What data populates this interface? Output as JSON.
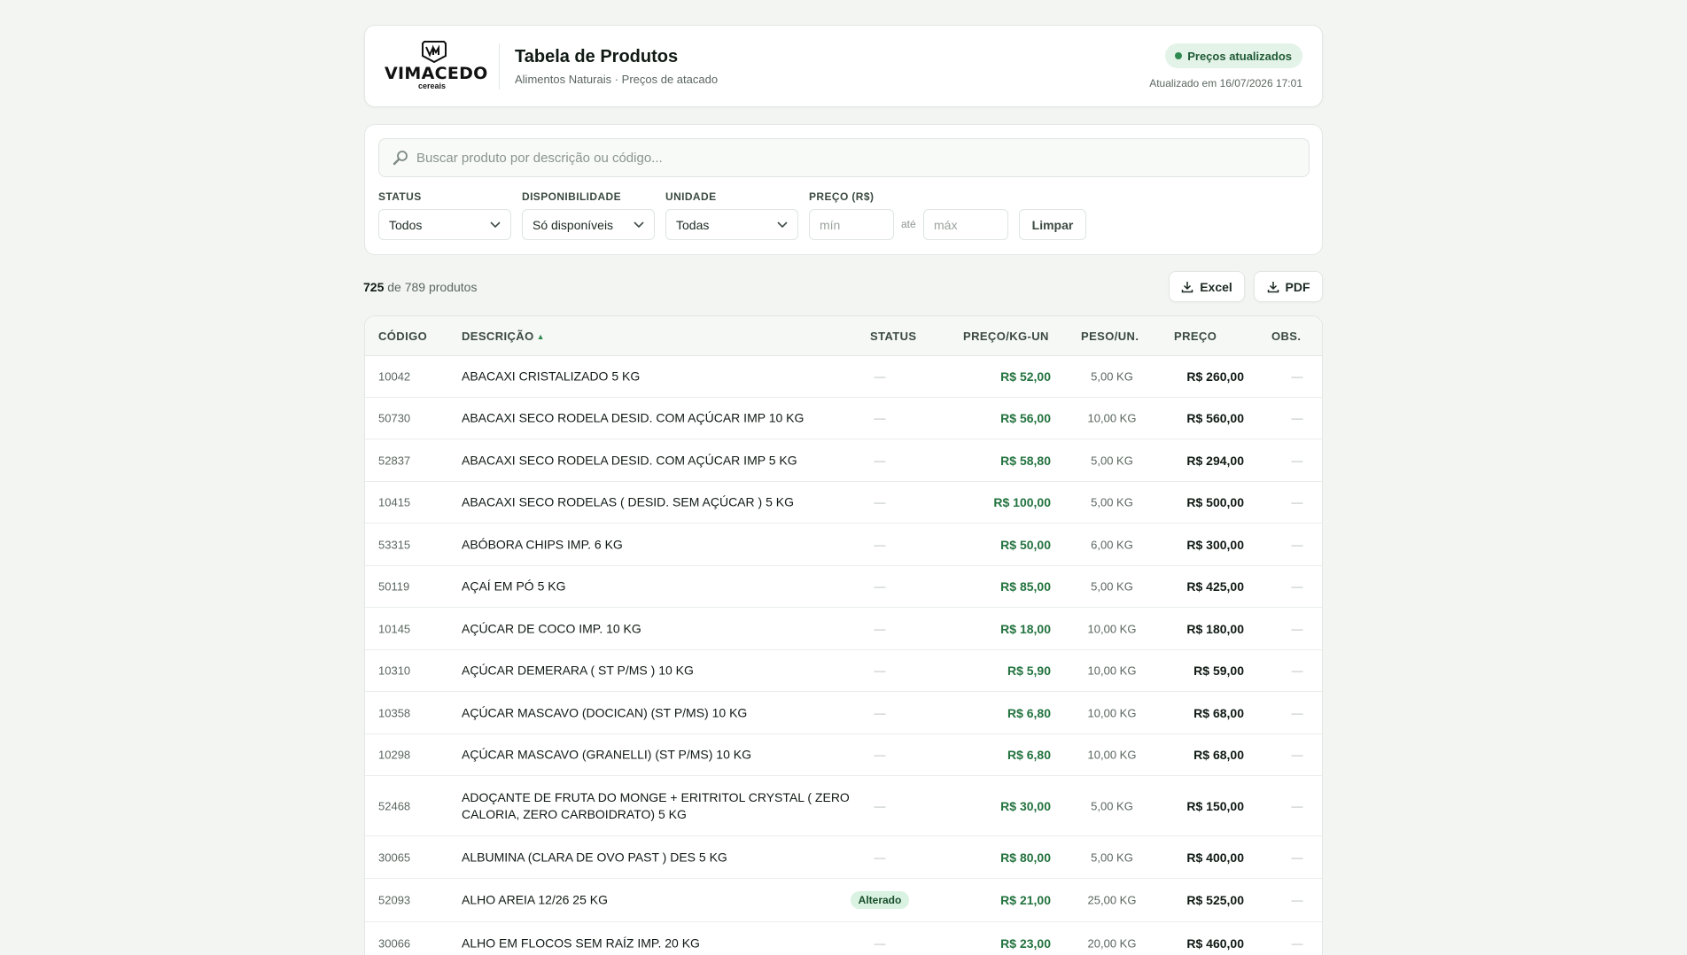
{
  "brand": {
    "logo_text": "VIMACEDO",
    "logo_sub": "cereais"
  },
  "header": {
    "title": "Tabela de Produtos",
    "subtitle": "Alimentos Naturais · Preços de atacado",
    "badge": "Preços atualizados",
    "updated_at": "Atualizado em 16/07/2026 17:01"
  },
  "search": {
    "placeholder": "Buscar produto por descrição ou código...",
    "value": ""
  },
  "filters": {
    "status": {
      "label": "STATUS",
      "value": "Todos"
    },
    "availability": {
      "label": "DISPONIBILIDADE",
      "value": "Só disponíveis"
    },
    "unit": {
      "label": "UNIDADE",
      "value": "Todas"
    },
    "price": {
      "label": "PREÇO (R$)",
      "min_placeholder": "mín",
      "max_placeholder": "máx",
      "separator": "até"
    },
    "clear_label": "Limpar"
  },
  "results": {
    "shown": "725",
    "total_text": "de 789 produtos"
  },
  "export": {
    "excel": "Excel",
    "pdf": "PDF"
  },
  "colors": {
    "accent": "#2e8b4f",
    "price_green": "#23733f",
    "badge_bg": "#e3f3e8"
  },
  "table": {
    "columns": {
      "code": "CÓDIGO",
      "description": "DESCRIÇÃO",
      "status": "STATUS",
      "price_per_kg": "PREÇO/KG-UN",
      "weight": "PESO/UN.",
      "price": "PREÇO",
      "obs": "OBS."
    },
    "sort_indicator": "▲",
    "rows": [
      {
        "code": "10042",
        "description": "ABACAXI CRISTALIZADO 5 KG",
        "status": "—",
        "price_per_kg": "R$ 52,00",
        "weight": "5,00 KG",
        "price": "R$ 260,00",
        "obs": "—"
      },
      {
        "code": "50730",
        "description": "ABACAXI SECO RODELA DESID. COM AÇÚCAR IMP 10 KG",
        "status": "—",
        "price_per_kg": "R$ 56,00",
        "weight": "10,00 KG",
        "price": "R$ 560,00",
        "obs": "—"
      },
      {
        "code": "52837",
        "description": "ABACAXI SECO RODELA DESID. COM AÇÚCAR IMP 5 KG",
        "status": "—",
        "price_per_kg": "R$ 58,80",
        "weight": "5,00 KG",
        "price": "R$ 294,00",
        "obs": "—"
      },
      {
        "code": "10415",
        "description": "ABACAXI SECO RODELAS ( DESID. SEM AÇÚCAR ) 5 KG",
        "status": "—",
        "price_per_kg": "R$ 100,00",
        "weight": "5,00 KG",
        "price": "R$ 500,00",
        "obs": "—"
      },
      {
        "code": "53315",
        "description": "ABÓBORA CHIPS IMP. 6 KG",
        "status": "—",
        "price_per_kg": "R$ 50,00",
        "weight": "6,00 KG",
        "price": "R$ 300,00",
        "obs": "—"
      },
      {
        "code": "50119",
        "description": "AÇAÍ EM PÓ 5 KG",
        "status": "—",
        "price_per_kg": "R$ 85,00",
        "weight": "5,00 KG",
        "price": "R$ 425,00",
        "obs": "—"
      },
      {
        "code": "10145",
        "description": "AÇÚCAR DE COCO IMP. 10 KG",
        "status": "—",
        "price_per_kg": "R$ 18,00",
        "weight": "10,00 KG",
        "price": "R$ 180,00",
        "obs": "—"
      },
      {
        "code": "10310",
        "description": "AÇÚCAR DEMERARA ( ST P/MS ) 10 KG",
        "status": "—",
        "price_per_kg": "R$ 5,90",
        "weight": "10,00 KG",
        "price": "R$ 59,00",
        "obs": "—"
      },
      {
        "code": "10358",
        "description": "AÇÚCAR MASCAVO (DOCICAN) (ST P/MS) 10 KG",
        "status": "—",
        "price_per_kg": "R$ 6,80",
        "weight": "10,00 KG",
        "price": "R$ 68,00",
        "obs": "—"
      },
      {
        "code": "10298",
        "description": "AÇÚCAR MASCAVO (GRANELLI) (ST P/MS) 10 KG",
        "status": "—",
        "price_per_kg": "R$ 6,80",
        "weight": "10,00 KG",
        "price": "R$ 68,00",
        "obs": "—"
      },
      {
        "code": "52468",
        "description": "ADOÇANTE DE FRUTA DO MONGE + ERITRITOL CRYSTAL ( ZERO CALORIA, ZERO CARBOIDRATO) 5 KG",
        "status": "—",
        "price_per_kg": "R$ 30,00",
        "weight": "5,00 KG",
        "price": "R$ 150,00",
        "obs": "—"
      },
      {
        "code": "30065",
        "description": "ALBUMINA (CLARA DE OVO PAST ) DES 5 KG",
        "status": "—",
        "price_per_kg": "R$ 80,00",
        "weight": "5,00 KG",
        "price": "R$ 400,00",
        "obs": "—"
      },
      {
        "code": "52093",
        "description": "ALHO AREIA 12/26 25 KG",
        "status": "Alterado",
        "price_per_kg": "R$ 21,00",
        "weight": "25,00 KG",
        "price": "R$ 525,00",
        "obs": "—"
      },
      {
        "code": "30066",
        "description": "ALHO EM FLOCOS SEM RAÍZ IMP. 20 KG",
        "status": "—",
        "price_per_kg": "R$ 23,00",
        "weight": "20,00 KG",
        "price": "R$ 460,00",
        "obs": "—"
      }
    ]
  }
}
